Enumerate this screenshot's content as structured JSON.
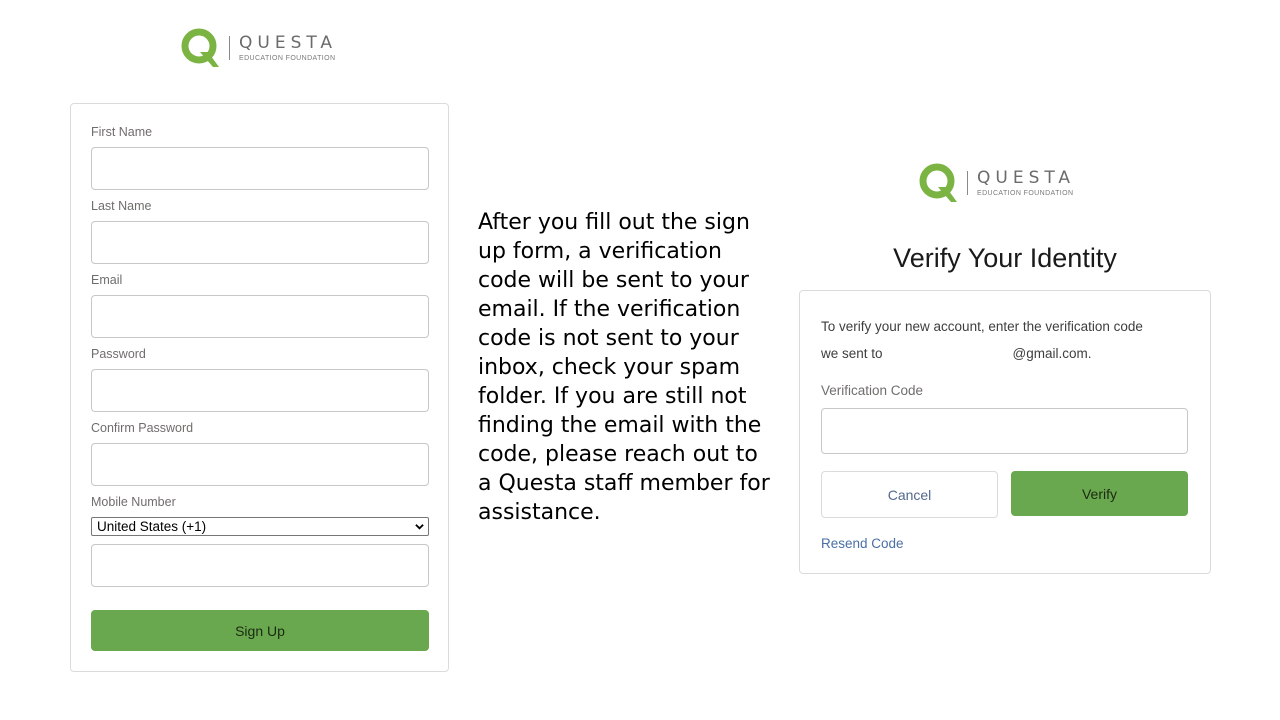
{
  "brand": {
    "name": "QUESTA",
    "subtitle": "EDUCATION FOUNDATION",
    "colors": {
      "green": "#6aa84f",
      "logo_green": "#7bb443",
      "logo_gray": "#6b6b6b"
    }
  },
  "signup_form": {
    "fields": {
      "first_name": {
        "label": "First Name",
        "value": ""
      },
      "last_name": {
        "label": "Last Name",
        "value": ""
      },
      "email": {
        "label": "Email",
        "value": ""
      },
      "password": {
        "label": "Password",
        "value": ""
      },
      "confirm_password": {
        "label": "Confirm Password",
        "value": ""
      },
      "mobile_number": {
        "label": "Mobile Number",
        "country": "United States (+1)",
        "value": ""
      }
    },
    "submit_label": "Sign Up"
  },
  "instructions": "After you fill out the sign up form, a verification code will be sent to your email. If the verification code is not sent to your inbox, check your spam folder. If you are still not finding the email with the code, please reach out to a Questa staff member for assistance.",
  "verify": {
    "title": "Verify Your Identity",
    "message_line1": "To verify your new account, enter the verification code",
    "message_prefix": "we sent to",
    "email_domain": "@gmail.com.",
    "code_label": "Verification Code",
    "code_value": "",
    "cancel_label": "Cancel",
    "verify_label": "Verify",
    "resend_label": "Resend Code"
  }
}
